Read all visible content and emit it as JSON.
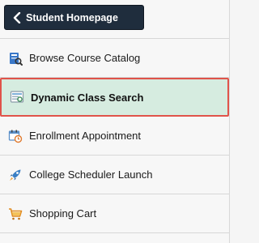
{
  "nav": {
    "home_button": {
      "label": "Student Homepage",
      "icon": "chevron-left-icon"
    },
    "items": [
      {
        "label": "Browse Course Catalog",
        "icon": "catalog-icon",
        "selected": false
      },
      {
        "label": "Dynamic Class Search",
        "icon": "class-search-icon",
        "selected": true
      },
      {
        "label": "Enrollment Appointment",
        "icon": "calendar-clock-icon",
        "selected": false
      },
      {
        "label": "College Scheduler Launch",
        "icon": "rocket-icon",
        "selected": false
      },
      {
        "label": "Shopping Cart",
        "icon": "shopping-cart-icon",
        "selected": false
      }
    ]
  },
  "colors": {
    "home_button_bg": "#1f2d3d",
    "selected_bg": "#d6ece0",
    "selected_border": "#e0534a"
  }
}
